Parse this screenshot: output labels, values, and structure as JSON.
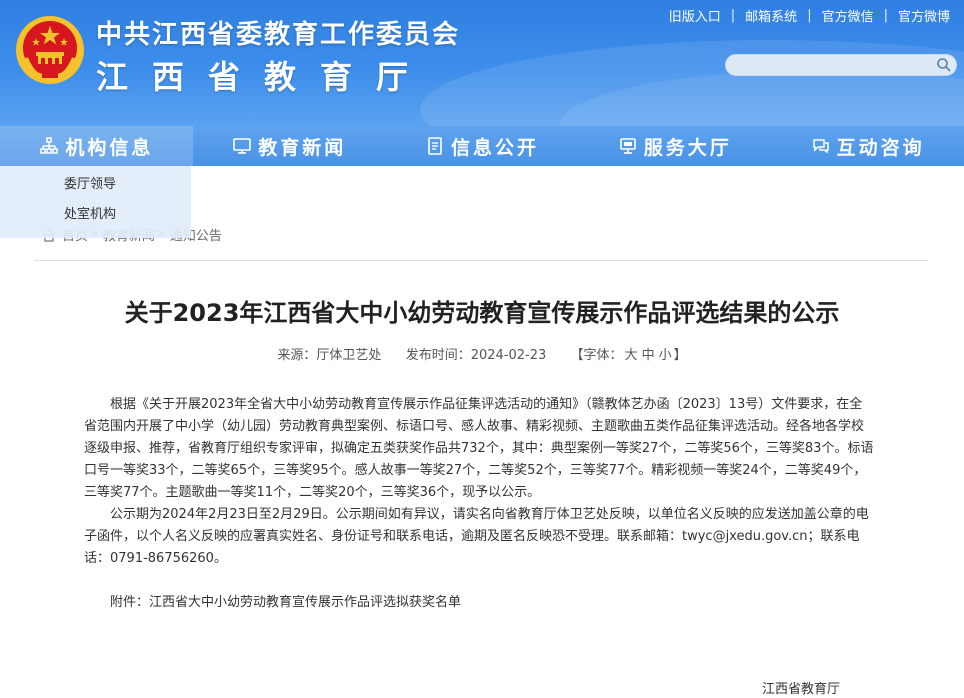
{
  "header": {
    "title_line1": "中共江西省委教育工作委员会",
    "title_line2": "江西省教育厅",
    "toplinks": [
      "旧版入口",
      "邮箱系统",
      "官方微信",
      "官方微博"
    ],
    "separator": "|",
    "search_placeholder": ""
  },
  "nav": {
    "items": [
      {
        "label": "机构信息",
        "icon": "org-chart-icon"
      },
      {
        "label": "教育新闻",
        "icon": "monitor-icon"
      },
      {
        "label": "信息公开",
        "icon": "document-icon"
      },
      {
        "label": "服务大厅",
        "icon": "service-icon"
      },
      {
        "label": "互动咨询",
        "icon": "chat-icon"
      }
    ],
    "dropdown": [
      "委厅领导",
      "处室机构"
    ]
  },
  "breadcrumb": {
    "home": "首页",
    "sep": ">",
    "news": "教育新闻",
    "notice": "通知公告"
  },
  "article": {
    "title": "关于2023年江西省大中小幼劳动教育宣传展示作品评选结果的公示",
    "source_label": "来源：厅体卫艺处",
    "date_label": "发布时间：2024-02-23",
    "font_label_open": "【字体：",
    "font_large": "大",
    "font_medium": "中",
    "font_small": "小",
    "font_label_close": "】",
    "para1": "根据《关于开展2023年全省大中小幼劳动教育宣传展示作品征集评选活动的通知》（赣教体艺办函〔2023〕13号）文件要求，在全省范围内开展了中小学（幼儿园）劳动教育典型案例、标语口号、感人故事、精彩视频、主题歌曲五类作品征集评选活动。经各地各学校逐级申报、推荐，省教育厅组织专家评审，拟确定五类获奖作品共732个，其中：典型案例一等奖27个，二等奖56个，三等奖83个。标语口号一等奖33个，二等奖65个，三等奖95个。感人故事一等奖27个，二等奖52个，三等奖77个。精彩视频一等奖24个，二等奖49个，三等奖77个。主题歌曲一等奖11个，二等奖20个，三等奖36个，现予以公示。",
    "para2": "公示期为2024年2月23日至2月29日。公示期间如有异议，请实名向省教育厅体卫艺处反映，以单位名义反映的应发送加盖公章的电子函件，以个人名义反映的应署真实姓名、身份证号和联系电话，逾期及匿名反映恐不受理。联系邮箱：twyc@jxedu.gov.cn；联系电话：0791-86756260。",
    "attachment": "附件：江西省大中小幼劳动教育宣传展示作品评选拟获奖名单",
    "signature": "江西省教育厅"
  },
  "colors": {
    "header_blue": "#3d8eec",
    "nav_blue": "#4a92e6",
    "emblem_red": "#d7171f",
    "emblem_gold": "#f4c22b"
  }
}
